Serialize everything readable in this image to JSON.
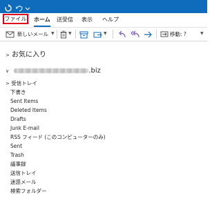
{
  "tabs": [
    {
      "label": "ファイル"
    },
    {
      "label": "ホーム"
    },
    {
      "label": "送受信"
    },
    {
      "label": "表示"
    },
    {
      "label": "ヘルプ"
    }
  ],
  "toolbar": {
    "new_mail_label": "新しいメール",
    "move_label": "移動: ?"
  },
  "favorites_label": "お気に入り",
  "account": {
    "domain_suffix": ".biz"
  },
  "folders": [
    {
      "label": "受信トレイ"
    },
    {
      "label": "下書き"
    },
    {
      "label": "Sent Items"
    },
    {
      "label": "Deleted Items"
    },
    {
      "label": "Drafts"
    },
    {
      "label": "Junk E-mail"
    },
    {
      "label": "RSS フィード (このコンピューターのみ)"
    },
    {
      "label": "Sent"
    },
    {
      "label": "Trash"
    },
    {
      "label": "議事録"
    },
    {
      "label": "送信トレイ"
    },
    {
      "label": "迷惑メール"
    },
    {
      "label": "検索フォルダー"
    }
  ],
  "colors": {
    "titlebar": "#0f6cbd",
    "highlight_box": "#e0001b"
  }
}
